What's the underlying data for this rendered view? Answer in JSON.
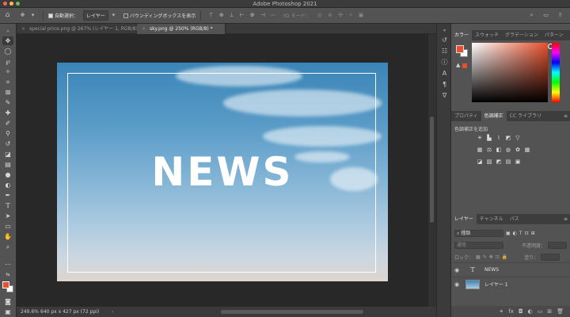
{
  "window": {
    "title": "Adobe Photoshop 2021"
  },
  "options_bar": {
    "auto_select_label": "自動選択：",
    "auto_select_target": "レイヤー",
    "bounding_box_label": "バウンディングボックスを表示",
    "mode_3d_label": "3D モード："
  },
  "document_tabs": [
    {
      "label": "special price.png @ 267% (レイヤー 1, RGB/8) *"
    },
    {
      "label": "sky.png @ 250% (RGB/8) *"
    }
  ],
  "canvas": {
    "text": "NEWS"
  },
  "status_bar": {
    "zoom": "249.6%",
    "doc_info": "640 px x 427 px (72 ppi)"
  },
  "panels": {
    "color_tabs": [
      "カラー",
      "スウォッチ",
      "グラデーション",
      "パターン"
    ],
    "adjust_tabs": [
      "プロパティ",
      "色調補正",
      "CC ライブラリ"
    ],
    "adjust_title": "色調補正を追加",
    "layers_tabs": [
      "レイヤー",
      "チャンネル",
      "パス"
    ],
    "layer_filter": "種類",
    "blend_mode": "通常",
    "opacity_label": "不透明度：",
    "lock_label": "ロック：",
    "fill_label": "塗り：",
    "layers": [
      {
        "name": "NEWS",
        "type": "text"
      },
      {
        "name": "レイヤー 1",
        "type": "image"
      }
    ]
  },
  "colors": {
    "foreground": "#e8502d",
    "background": "#ffffff"
  }
}
